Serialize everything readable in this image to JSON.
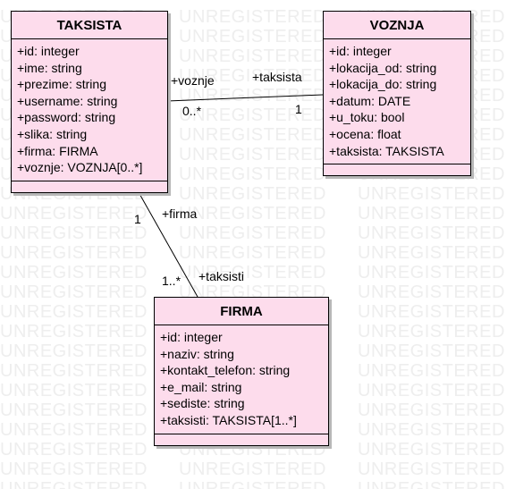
{
  "watermark": "UNREGISTERED",
  "classes": [
    {
      "name": "TAKSISTA",
      "attrs": [
        "+id: integer",
        "+ime: string",
        "+prezime: string",
        "+username: string",
        "+password: string",
        "+slika: string",
        "+firma: FIRMA",
        "+voznje: VOZNJA[0..*]"
      ]
    },
    {
      "name": "VOZNJA",
      "attrs": [
        "+id: integer",
        "+lokacija_od: string",
        "+lokacija_do: string",
        "+datum: DATE",
        "+u_toku: bool",
        "+ocena: float",
        "+taksista: TAKSISTA"
      ]
    },
    {
      "name": "FIRMA",
      "attrs": [
        "+id: integer",
        "+naziv: string",
        "+kontakt_telefon: string",
        "+e_mail: string",
        "+sediste: string",
        "+taksisti: TAKSISTA[1..*]"
      ]
    }
  ],
  "associations": {
    "taksista_voznja": {
      "role_near_taksista": "+voznje",
      "mult_near_taksista": "0..*",
      "role_near_voznja": "+taksista",
      "mult_near_voznja": "1"
    },
    "taksista_firma": {
      "role_near_taksista": "+firma",
      "mult_near_taksista": "1",
      "role_near_firma": "+taksisti",
      "mult_near_firma": "1..*"
    }
  }
}
